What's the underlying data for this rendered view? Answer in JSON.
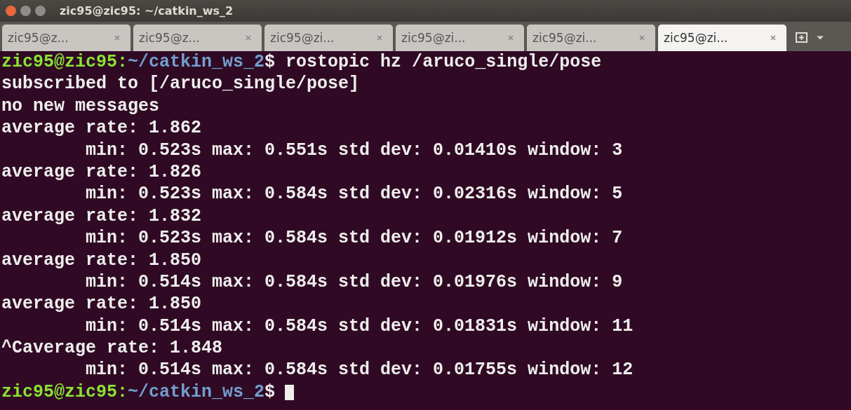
{
  "window": {
    "title": "zic95@zic95: ~/catkin_ws_2"
  },
  "tabs": [
    {
      "label": "zic95@z...",
      "selected": false
    },
    {
      "label": "zic95@z...",
      "selected": false
    },
    {
      "label": "zic95@zi...",
      "selected": false
    },
    {
      "label": "zic95@zi...",
      "selected": false
    },
    {
      "label": "zic95@zi...",
      "selected": false
    },
    {
      "label": "zic95@zi...",
      "selected": true
    }
  ],
  "terminal": {
    "cursor_visible": true,
    "lines": [
      {
        "kind": "prompt",
        "user": "zic95@zic95:",
        "path": "~/catkin_ws_2",
        "symbol": "$",
        "command": "rostopic hz /aruco_single/pose"
      },
      {
        "kind": "output",
        "text": "subscribed to [/aruco_single/pose]"
      },
      {
        "kind": "output",
        "text": "no new messages"
      },
      {
        "kind": "output",
        "text": "average rate: 1.862"
      },
      {
        "kind": "output",
        "text": "        min: 0.523s max: 0.551s std dev: 0.01410s window: 3"
      },
      {
        "kind": "output",
        "text": "average rate: 1.826"
      },
      {
        "kind": "output",
        "text": "        min: 0.523s max: 0.584s std dev: 0.02316s window: 5"
      },
      {
        "kind": "output",
        "text": "average rate: 1.832"
      },
      {
        "kind": "output",
        "text": "        min: 0.523s max: 0.584s std dev: 0.01912s window: 7"
      },
      {
        "kind": "output",
        "text": "average rate: 1.850"
      },
      {
        "kind": "output",
        "text": "        min: 0.514s max: 0.584s std dev: 0.01976s window: 9"
      },
      {
        "kind": "output",
        "text": "average rate: 1.850"
      },
      {
        "kind": "output",
        "text": "        min: 0.514s max: 0.584s std dev: 0.01831s window: 11"
      },
      {
        "kind": "output",
        "text": "^Caverage rate: 1.848"
      },
      {
        "kind": "output",
        "text": "        min: 0.514s max: 0.584s std dev: 0.01755s window: 12"
      },
      {
        "kind": "prompt",
        "user": "zic95@zic95:",
        "path": "~/catkin_ws_2",
        "symbol": "$"
      }
    ]
  }
}
